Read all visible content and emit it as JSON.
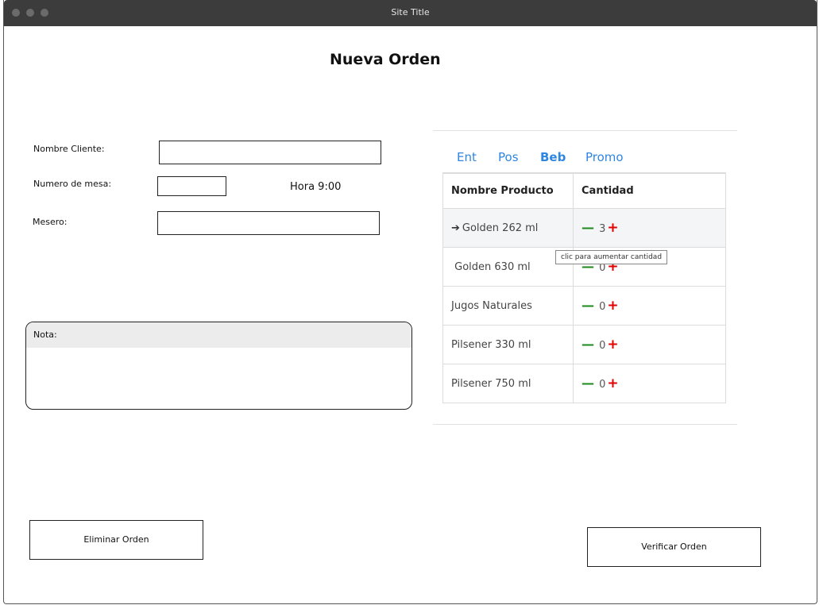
{
  "window": {
    "title": "Site Title"
  },
  "page": {
    "heading": "Nueva Orden"
  },
  "form": {
    "cliente_label": "Nombre Cliente:",
    "mesa_label": "Numero de mesa:",
    "hora_text": "Hora 9:00",
    "mesero_label": "Mesero:"
  },
  "nota": {
    "label": "Nota:"
  },
  "menu": {
    "tabs": [
      {
        "label": "Ent"
      },
      {
        "label": "Pos"
      },
      {
        "label": "Beb"
      },
      {
        "label": "Promo"
      }
    ],
    "active_tab": "Beb",
    "columns": [
      "Nombre Producto",
      "Cantidad"
    ],
    "items": [
      {
        "name": "Golden 262 ml",
        "qty": "3",
        "selected": true
      },
      {
        "name": "Golden 630 ml",
        "qty": "0"
      },
      {
        "name": "Jugos Naturales",
        "qty": "0"
      },
      {
        "name": "Pilsener 330 ml",
        "qty": "0"
      },
      {
        "name": "Pilsener 750 ml",
        "qty": "0"
      }
    ],
    "tooltip": "clic para aumentar cantidad"
  },
  "actions": {
    "eliminar_label": "Eliminar Orden",
    "verificar_label": "Verificar Orden"
  },
  "colors": {
    "tab_link": "#2f86e0",
    "minus": "#1e8a1e",
    "plus": "#e30000"
  }
}
